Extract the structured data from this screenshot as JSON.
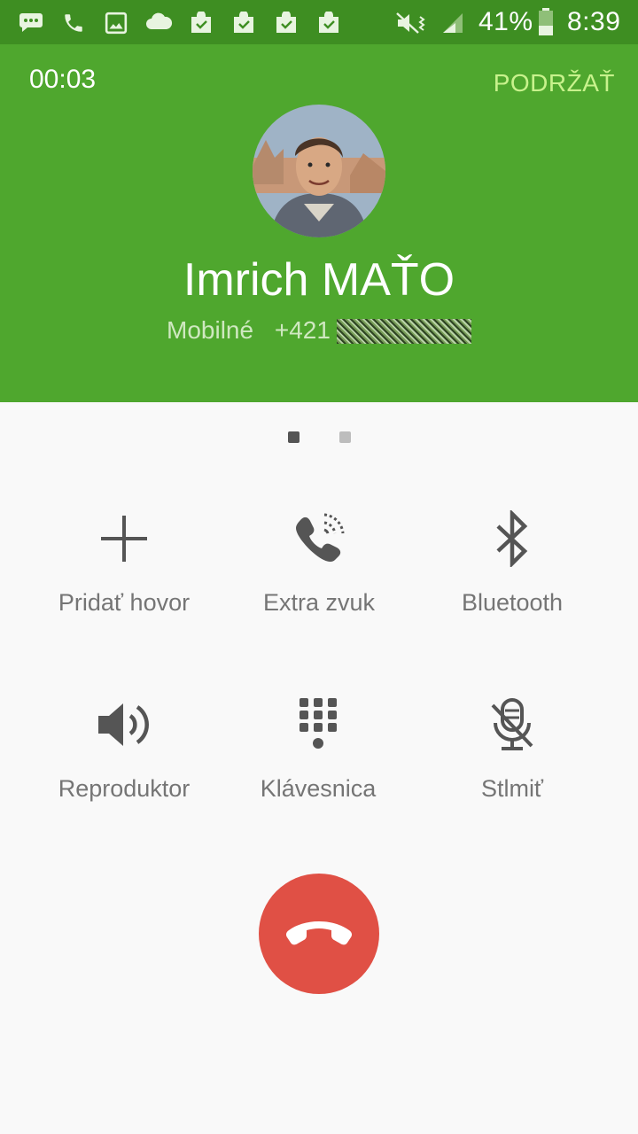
{
  "status_bar": {
    "icons": [
      "messages-icon",
      "phone-icon",
      "gallery-icon",
      "cloud-icon",
      "store-icon",
      "store-icon",
      "store-icon",
      "store-icon"
    ],
    "right_icons": [
      "mute-vibrate-icon",
      "signal-icon"
    ],
    "battery_percent": "41%",
    "battery_level": 0.41,
    "time": "8:39",
    "color": "#3e8e22"
  },
  "call_header": {
    "timer": "00:03",
    "hold_label": "PODRŽAŤ",
    "contact_name": "Imrich MAŤO",
    "number_type": "Mobilné",
    "number_prefix": "+421",
    "color": "#4fa72e"
  },
  "pager": {
    "pages": 2,
    "active_index": 0
  },
  "actions": [
    {
      "id": "add-call",
      "label": "Pridať hovor",
      "icon": "plus-icon"
    },
    {
      "id": "extra-volume",
      "label": "Extra zvuk",
      "icon": "phone-volume-icon"
    },
    {
      "id": "bluetooth",
      "label": "Bluetooth",
      "icon": "bluetooth-icon"
    },
    {
      "id": "speaker",
      "label": "Reproduktor",
      "icon": "speaker-icon"
    },
    {
      "id": "keypad",
      "label": "Klávesnica",
      "icon": "dialpad-icon"
    },
    {
      "id": "mute",
      "label": "Stlmiť",
      "icon": "mic-off-icon"
    }
  ],
  "end_call": {
    "icon": "hang-up-icon",
    "color": "#e05045"
  }
}
